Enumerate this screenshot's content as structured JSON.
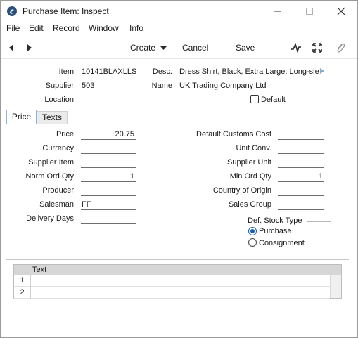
{
  "window": {
    "title": "Purchase Item: Inspect"
  },
  "menu": [
    "File",
    "Edit",
    "Record",
    "Window",
    "Info"
  ],
  "toolbar": {
    "create_label": "Create",
    "cancel_label": "Cancel",
    "save_label": "Save"
  },
  "header": {
    "item_label": "Item",
    "item_value": "10141BLAXLLS",
    "desc_label": "Desc.",
    "desc_value": "Dress Shirt, Black, Extra Large, Long-slee",
    "supplier_label": "Supplier",
    "supplier_value": "503",
    "name_label": "Name",
    "name_value": "UK Trading Company Ltd",
    "location_label": "Location",
    "location_value": "",
    "default_label": "Default",
    "default_checked": false
  },
  "tabs": [
    {
      "label": "Price",
      "active": true
    },
    {
      "label": "Texts",
      "active": false
    }
  ],
  "price_tab": {
    "left": [
      {
        "label": "Price",
        "value": "20.75",
        "align": "right"
      },
      {
        "label": "Currency",
        "value": ""
      },
      {
        "label": "Supplier Item",
        "value": ""
      },
      {
        "label": "Norm Ord Qty",
        "value": "1",
        "align": "right"
      },
      {
        "label": "Producer",
        "value": ""
      },
      {
        "label": "Salesman",
        "value": "FF"
      },
      {
        "label": "Delivery Days",
        "value": ""
      }
    ],
    "right": [
      {
        "label": "Default Customs Cost",
        "value": ""
      },
      {
        "label": "Unit Conv.",
        "value": ""
      },
      {
        "label": "Supplier Unit",
        "value": ""
      },
      {
        "label": "Min Ord Qty",
        "value": "1",
        "align": "right"
      },
      {
        "label": "Country of Origin",
        "value": ""
      },
      {
        "label": "Sales Group",
        "value": ""
      }
    ],
    "stock_type": {
      "title": "Def. Stock Type",
      "options": [
        "Purchase",
        "Consignment"
      ],
      "selected": "Purchase"
    }
  },
  "grid": {
    "column": "Text",
    "rows": [
      "1",
      "2"
    ]
  },
  "colors": {
    "accent": "#1a5fb4",
    "tab_border": "#8ab4dc"
  }
}
